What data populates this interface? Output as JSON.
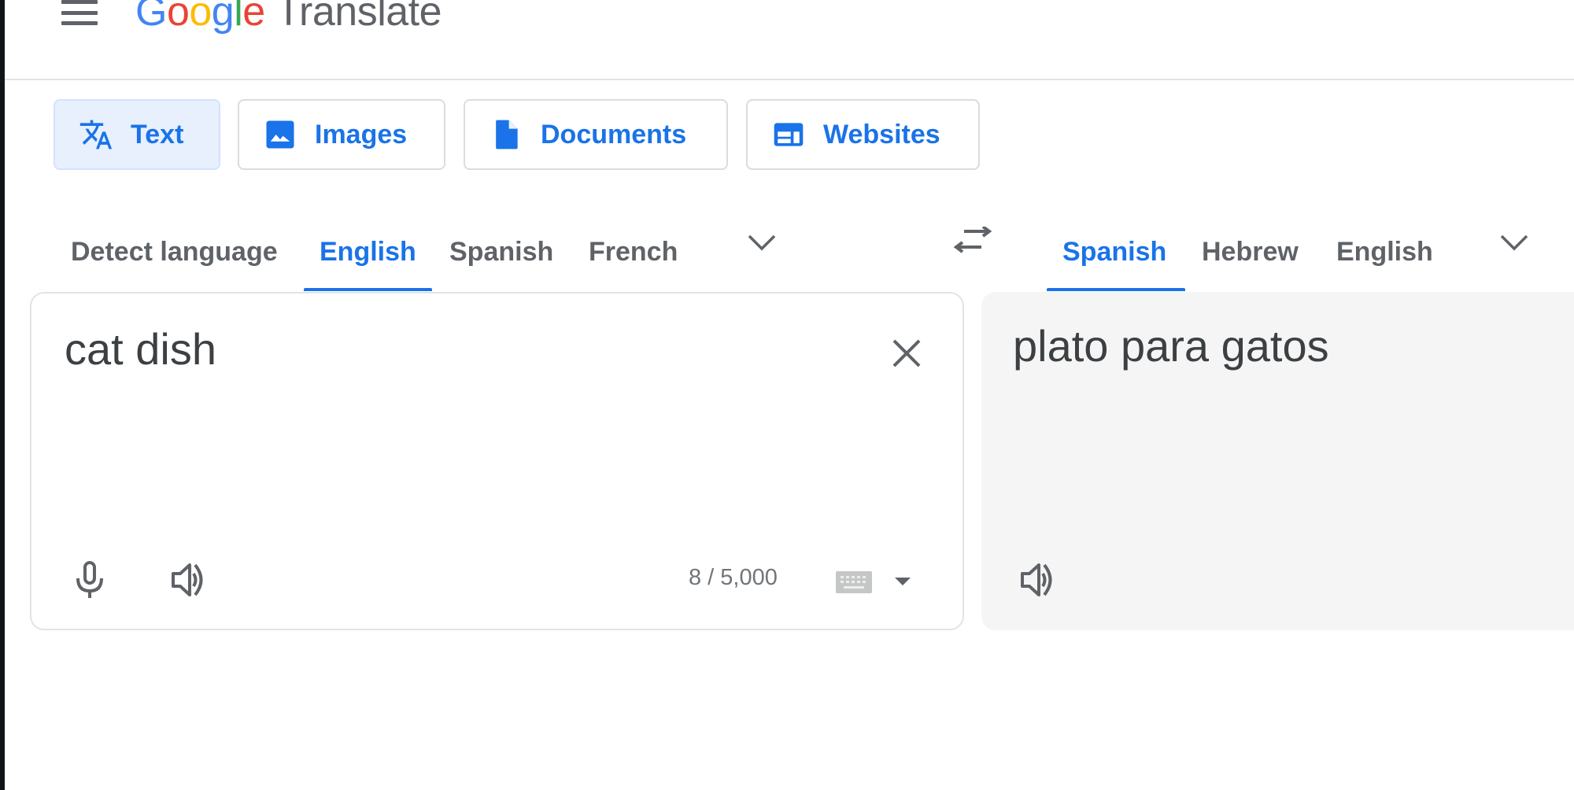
{
  "header": {
    "logo_letters": [
      "G",
      "o",
      "o",
      "g",
      "l",
      "e"
    ],
    "product_name": "Translate"
  },
  "modes": [
    {
      "label": "Text",
      "icon": "translate-icon",
      "active": true
    },
    {
      "label": "Images",
      "icon": "image-icon",
      "active": false
    },
    {
      "label": "Documents",
      "icon": "document-icon",
      "active": false
    },
    {
      "label": "Websites",
      "icon": "website-icon",
      "active": false
    }
  ],
  "source_languages": [
    {
      "label": "Detect language",
      "active": false
    },
    {
      "label": "English",
      "active": true
    },
    {
      "label": "Spanish",
      "active": false
    },
    {
      "label": "French",
      "active": false
    }
  ],
  "target_languages": [
    {
      "label": "Spanish",
      "active": true
    },
    {
      "label": "Hebrew",
      "active": false
    },
    {
      "label": "English",
      "active": false
    }
  ],
  "source": {
    "text": "cat dish",
    "char_count": "8 / 5,000"
  },
  "target": {
    "text": "plato para gatos"
  },
  "colors": {
    "accent": "#1a73e8",
    "active_mode_bg": "#e8f0fe",
    "output_bg": "#f5f5f5",
    "icon_gray": "#5f6368"
  }
}
